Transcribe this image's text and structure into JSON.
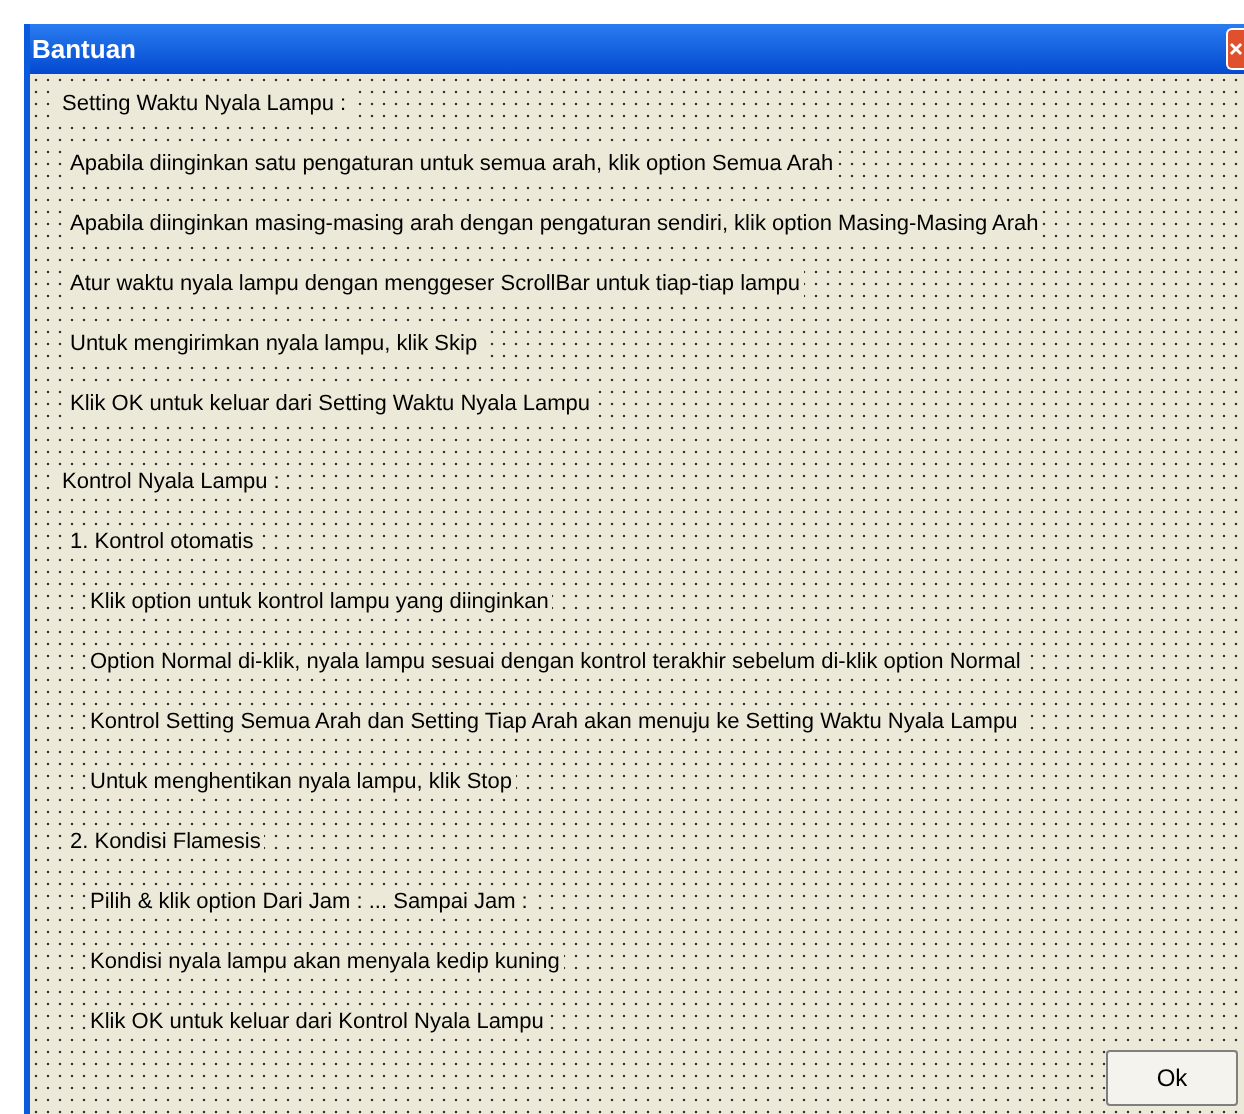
{
  "window": {
    "title": "Bantuan"
  },
  "sections": [
    {
      "title": "Setting Waktu Nyala Lampu :",
      "items": [
        {
          "text": "Apabila diinginkan satu pengaturan untuk semua arah, klik option Semua Arah"
        },
        {
          "text": "Apabila diinginkan masing-masing arah dengan pengaturan sendiri, klik option Masing-Masing Arah"
        },
        {
          "text": "Atur waktu nyala lampu dengan menggeser ScrollBar untuk tiap-tiap lampu"
        },
        {
          "text": "Untuk mengirimkan nyala lampu, klik Skip"
        },
        {
          "text": "Klik OK untuk keluar dari Setting Waktu Nyala Lampu"
        }
      ]
    },
    {
      "title": "Kontrol Nyala Lampu :",
      "items": [
        {
          "text": "1. Kontrol otomatis",
          "children": [
            {
              "text": "Klik option untuk kontrol lampu yang diinginkan"
            },
            {
              "text": "Option Normal di-klik, nyala lampu sesuai dengan kontrol terakhir sebelum di-klik option Normal"
            },
            {
              "text": "Kontrol Setting Semua Arah dan Setting Tiap Arah akan menuju ke Setting Waktu Nyala Lampu"
            },
            {
              "text": "Untuk menghentikan nyala lampu, klik Stop"
            }
          ]
        },
        {
          "text": "2. Kondisi Flamesis",
          "children": [
            {
              "text": "Pilih & klik option Dari Jam : ... Sampai Jam :"
            },
            {
              "text": "Kondisi nyala lampu akan menyala kedip kuning"
            },
            {
              "text": "Klik OK untuk keluar dari Kontrol Nyala Lampu"
            }
          ]
        }
      ]
    }
  ],
  "buttons": {
    "ok": "Ok"
  }
}
